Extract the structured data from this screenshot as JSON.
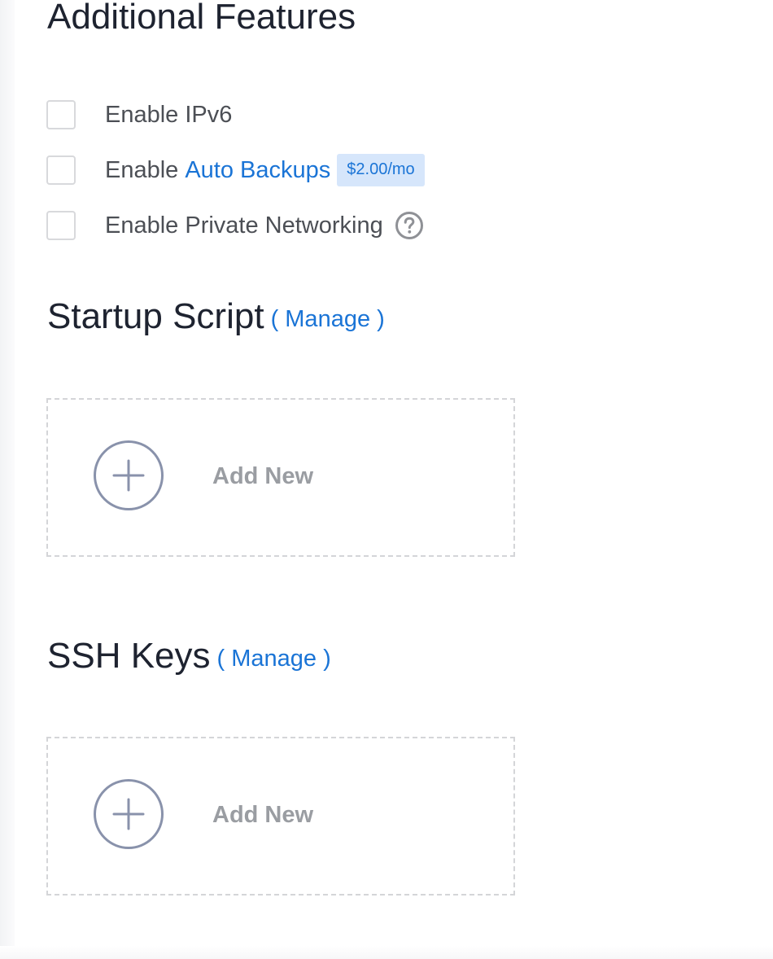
{
  "colors": {
    "link": "#1a74d6",
    "badge_bg": "#d6e6fb",
    "muted": "#9a9da2",
    "icon_stroke": "#8992ab",
    "heading": "#1e2330"
  },
  "features": {
    "title": "Additional Features",
    "options": [
      {
        "prefix": "Enable IPv6",
        "checked": false
      },
      {
        "prefix": "Enable",
        "link": "Auto Backups",
        "badge": "$2.00/mo",
        "checked": false
      },
      {
        "prefix": "Enable Private Networking",
        "icon": "help-circle-icon",
        "checked": false
      }
    ]
  },
  "startup_script": {
    "title": "Startup Script",
    "manage_label": "( Manage )",
    "add_label": "Add New",
    "icon": "plus-circle-icon"
  },
  "ssh_keys": {
    "title": "SSH Keys",
    "manage_label": "( Manage )",
    "add_label": "Add New",
    "icon": "plus-circle-icon"
  }
}
